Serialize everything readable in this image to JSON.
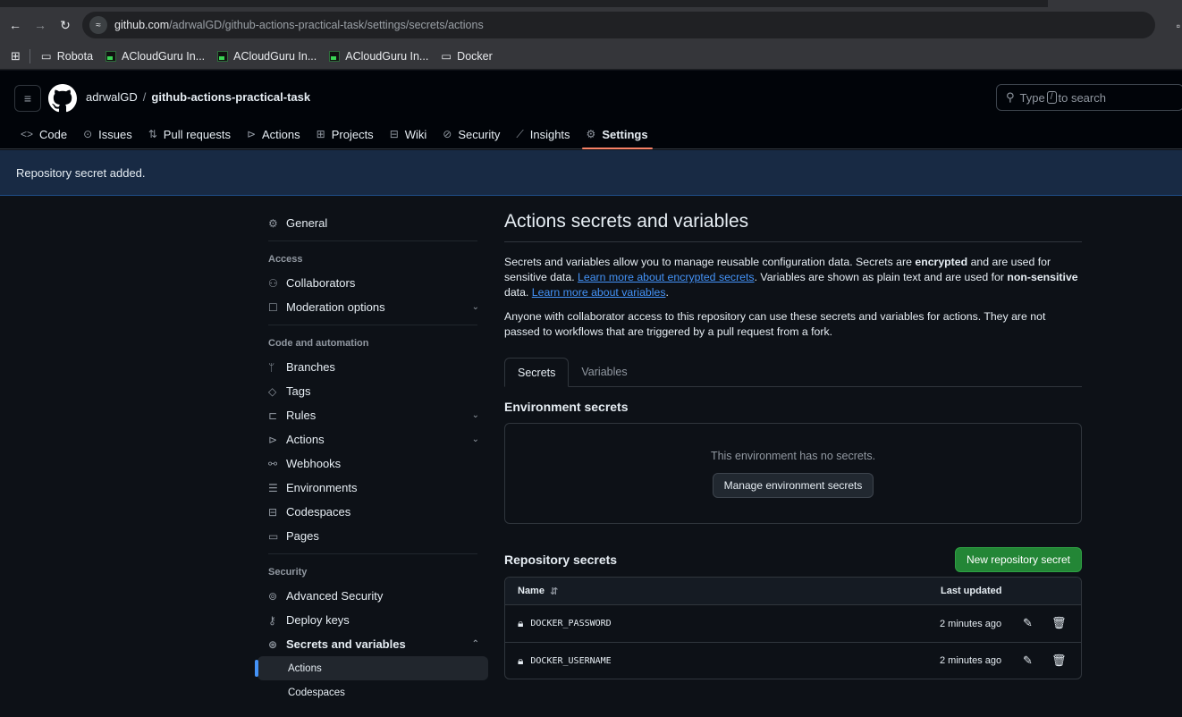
{
  "browser": {
    "url_host": "github.com",
    "url_path": "/adrwalGD/github-actions-practical-task/settings/secrets/actions",
    "bookmarks": [
      {
        "label": "Robota",
        "type": "folder"
      },
      {
        "label": "ACloudGuru In...",
        "type": "site"
      },
      {
        "label": "ACloudGuru In...",
        "type": "site"
      },
      {
        "label": "ACloudGuru In...",
        "type": "site"
      },
      {
        "label": "Docker",
        "type": "folder"
      }
    ]
  },
  "header": {
    "owner": "adrwalGD",
    "repo": "github-actions-practical-task",
    "search": {
      "prefix": "Type",
      "key": "/",
      "suffix": "to search"
    }
  },
  "repo_nav": [
    {
      "label": "Code",
      "icon": "code-icon",
      "glyph": "<>"
    },
    {
      "label": "Issues",
      "icon": "issue-icon",
      "glyph": "⊙"
    },
    {
      "label": "Pull requests",
      "icon": "pull-request-icon",
      "glyph": "⇅"
    },
    {
      "label": "Actions",
      "icon": "play-icon",
      "glyph": "⊳"
    },
    {
      "label": "Projects",
      "icon": "table-icon",
      "glyph": "⊞"
    },
    {
      "label": "Wiki",
      "icon": "book-icon",
      "glyph": "⊟"
    },
    {
      "label": "Security",
      "icon": "shield-icon",
      "glyph": "⊘"
    },
    {
      "label": "Insights",
      "icon": "graph-icon",
      "glyph": "⟋"
    },
    {
      "label": "Settings",
      "icon": "gear-icon",
      "glyph": "⚙",
      "active": true
    }
  ],
  "flash": {
    "message": "Repository secret added."
  },
  "sidebar": {
    "general": "General",
    "access_heading": "Access",
    "collaborators": "Collaborators",
    "moderation": "Moderation options",
    "code_heading": "Code and automation",
    "branches": "Branches",
    "tags": "Tags",
    "rules": "Rules",
    "actions": "Actions",
    "webhooks": "Webhooks",
    "environments": "Environments",
    "codespaces": "Codespaces",
    "pages": "Pages",
    "security_heading": "Security",
    "advanced_security": "Advanced Security",
    "deploy_keys": "Deploy keys",
    "secrets_vars": "Secrets and variables",
    "sub_actions": "Actions",
    "sub_codespaces": "Codespaces"
  },
  "main": {
    "title": "Actions secrets and variables",
    "desc_1": "Secrets and variables allow you to manage reusable configuration data. Secrets are",
    "desc_bold_1": "encrypted",
    "desc_2": "and are used for sensitive data.",
    "link_1": "Learn more about encrypted secrets",
    "desc_3": ". Variables are shown as plain text and are used for",
    "desc_bold_2": "non-sensitive",
    "desc_4": "data.",
    "link_2": "Learn more about variables",
    "desc_5": ".",
    "desc_p2": "Anyone with collaborator access to this repository can use these secrets and variables for actions. They are not passed to workflows that are triggered by a pull request from a fork.",
    "tabs": [
      "Secrets",
      "Variables"
    ],
    "env_title": "Environment secrets",
    "env_empty": "This environment has no secrets.",
    "env_button": "Manage environment secrets",
    "repo_title": "Repository secrets",
    "new_secret_button": "New repository secret",
    "table": {
      "col_name": "Name",
      "col_updated": "Last updated",
      "rows": [
        {
          "name": "DOCKER_PASSWORD",
          "updated": "2 minutes ago"
        },
        {
          "name": "DOCKER_USERNAME",
          "updated": "2 minutes ago"
        }
      ]
    }
  }
}
